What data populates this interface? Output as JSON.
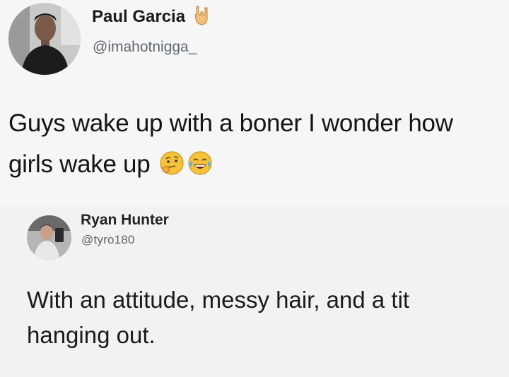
{
  "tweets": [
    {
      "name": "Paul Garcia",
      "handle": "@imahotnigga_",
      "name_emoji_icon": "rock-on-hand-icon",
      "text": "Guys wake up with a boner I wonder how girls wake up",
      "trailing_emojis": [
        "thinking-face-icon",
        "tears-of-joy-face-icon"
      ]
    },
    {
      "name": "Ryan Hunter",
      "handle": "@tyro180",
      "text": "With an attitude, messy hair, and a tit hanging out."
    }
  ],
  "colors": {
    "background": "#f4f4f4",
    "handle": "#5f6770",
    "emoji_yellow": "#f5c33b"
  }
}
